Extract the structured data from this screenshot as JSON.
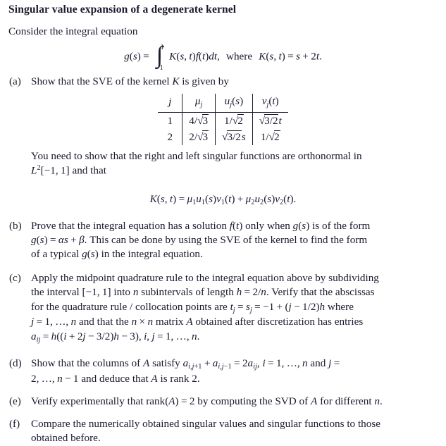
{
  "document": {
    "title": "Singular value expansion of a degenerate kernel",
    "lead": "Consider the integral equation",
    "equation_1": "g(s) = ∫_{-1}^{1} K(s,t)f(t)dt,  where K(s,t) = s + 2t.",
    "equation_2": "K(s,t) = μ₁u₁(s)v₁(t) + μ₂u₂(s)v₂(t).",
    "integral": {
      "upper_limit": "1",
      "lower_limit": "−1"
    }
  },
  "items": [
    {
      "marker": "(a)",
      "text_intro": "Show that the SVE of the kernel K is given by",
      "text_after_line1": "You need to show that the right and left singular functions are orthonormal in",
      "text_after_line2": "L²[−1, 1] and that"
    },
    {
      "marker": "(b)",
      "line1": "Prove that the integral equation has a solution f(t) only when g(s) is of the form",
      "line2": "g(s) = αs + β. This can be done by using the SVE of the kernel to find the form",
      "line3": "of a typical g(s) in the integral equation."
    },
    {
      "marker": "(c)",
      "line1": "Apply the midpoint quadrature rule to the integral equation above by subdividing",
      "line2": "the interval [−1, 1] into n subintervals of length h = 2/n. Verify that the abscissas",
      "line3": "for the quadrature rule / collocation points are tⱼ = sⱼ = −1 + (j − 1/2)h where",
      "line4": "j = 1, … , n and that the n × n matrix A obtained after discretization has entries",
      "line5": "aᵢⱼ = h((i + 2j − 3/2)h − 3), i, j = 1, … , n."
    },
    {
      "marker": "(d)",
      "line1": "Show that the columns of A satisfy aᵢ,ⱼ₊₁ + aᵢ,ⱼ₋₁ = 2aᵢⱼ, i = 1, … , n and j =",
      "line2": "2, … , n − 1 and deduce that A is rank 2."
    },
    {
      "marker": "(e)",
      "line1": "Verify experimentally that rank(A) = 2 by computing the SVD of A for different n."
    },
    {
      "marker": "(f)",
      "line1": "Compare the numerically obtained singular values and singular functions to those",
      "line2": "obtained before."
    }
  ],
  "sve_table": {
    "headers": [
      "j",
      "μⱼ",
      "uⱼ(s)",
      "vⱼ(t)"
    ],
    "rows": [
      {
        "j": "1",
        "mu": "4/√3",
        "u": "1/√2",
        "v": "√(3/2)t"
      },
      {
        "j": "2",
        "mu": "2/√3",
        "u": "√(3/2)s",
        "v": "1/√2"
      }
    ]
  },
  "colors": {
    "text": "#1a1a2e",
    "background": "#ffffff",
    "rule": "#1a1a2e"
  }
}
